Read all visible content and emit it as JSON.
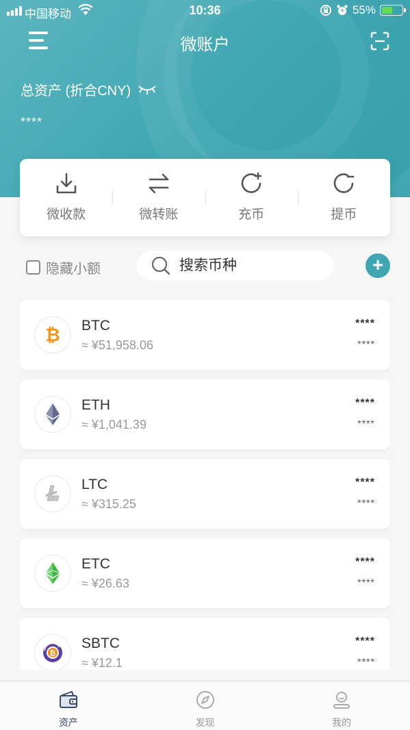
{
  "status_bar": {
    "carrier": "中国移动",
    "time": "10:36",
    "battery": "55%",
    "battery_level": 0.55
  },
  "nav": {
    "title": "微账户"
  },
  "assets": {
    "total_label": "总资产 (折合CNY)",
    "total_value": "****"
  },
  "actions": [
    {
      "label": "微收款",
      "icon": "download-icon"
    },
    {
      "label": "微转账",
      "icon": "transfer-arrows-icon"
    },
    {
      "label": "充币",
      "icon": "refresh-plus-icon"
    },
    {
      "label": "提币",
      "icon": "refresh-minus-icon"
    }
  ],
  "filter": {
    "hide_small_label": "隐藏小额",
    "hide_small_checked": false,
    "search_placeholder": "搜索币种",
    "add_label": "+"
  },
  "coins": [
    {
      "symbol": "BTC",
      "price": "≈ ¥51,958.06",
      "amount": "****",
      "value": "****",
      "icon": "bitcoin-icon",
      "color": "#f7931a"
    },
    {
      "symbol": "ETH",
      "price": "≈ ¥1,041.39",
      "amount": "****",
      "value": "****",
      "icon": "ethereum-icon",
      "color": "#627eea"
    },
    {
      "symbol": "LTC",
      "price": "≈ ¥315.25",
      "amount": "****",
      "value": "****",
      "icon": "litecoin-icon",
      "color": "#bebebe"
    },
    {
      "symbol": "ETC",
      "price": "≈ ¥26.63",
      "amount": "****",
      "value": "****",
      "icon": "ethereum-classic-icon",
      "color": "#3ab83a"
    },
    {
      "symbol": "SBTC",
      "price": "≈ ¥12.1",
      "amount": "****",
      "value": "****",
      "icon": "super-bitcoin-icon",
      "color": "#5b3fa0"
    }
  ],
  "tabs": [
    {
      "label": "资产",
      "icon": "wallet-icon",
      "active": true
    },
    {
      "label": "发现",
      "icon": "compass-icon",
      "active": false
    },
    {
      "label": "我的",
      "icon": "profile-icon",
      "active": false
    }
  ],
  "colors": {
    "primary": "#3fa6b1",
    "tab_active": "#3a4a6b"
  }
}
